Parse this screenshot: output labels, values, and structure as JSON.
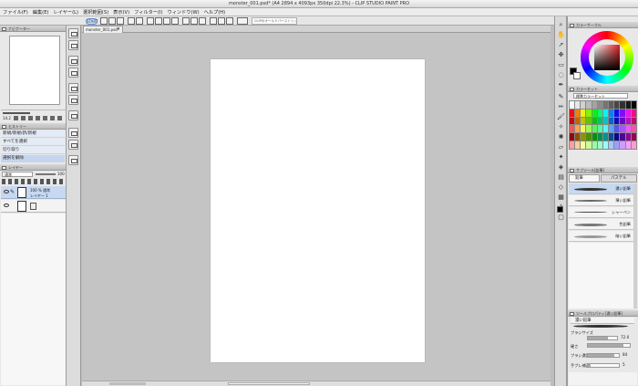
{
  "title": "monster_001.psd* (A4 2894 x 4093px 350dpi 22.3%) - CLIP STUDIO PAINT PRO",
  "menu": [
    "ファイル(F)",
    "編集(E)",
    "レイヤー(L)",
    "選択範囲(S)",
    "表示(V)",
    "フィルター(I)",
    "ウィンドウ(W)",
    "ヘルプ(H)"
  ],
  "cmd": {
    "start_label": "START",
    "search_placeholder": "CLIPのオールドバーストリップ"
  },
  "document_tab": "monster_001.psd*",
  "navigator": {
    "title": "ナビゲーター",
    "zoom": "14.2"
  },
  "history": {
    "title": "ヒストリー",
    "items": [
      "新規/新規/新/新規",
      "すべてを選択",
      "切り取り",
      "選択を解除"
    ]
  },
  "layers": {
    "title": "レイヤー",
    "blend": "通常",
    "opacity": "100",
    "rows": [
      {
        "name": "100 % 通常",
        "sub": "レイヤー 1"
      }
    ]
  },
  "color_wheel": {
    "title": "カラーサークル"
  },
  "color_set": {
    "title": "カラーセット",
    "set_name": "標準カラーセット"
  },
  "subtool": {
    "title": "サブツール[鉛筆]",
    "tabs": [
      "鉛筆",
      "パステル"
    ],
    "brushes": [
      "濃い鉛筆",
      "薄い鉛筆",
      "シャーペン",
      "色鉛筆",
      "暗い鉛筆"
    ]
  },
  "tool_property": {
    "title": "ツールプロパティ[濃い鉛筆]",
    "name": "濃い鉛筆",
    "brush_size_label": "ブラシサイズ",
    "brush_size": "72.0",
    "hardness_label": "硬さ",
    "density_label": "ブラシ濃度",
    "density": "84",
    "correction_label": "手ブレ補正",
    "correction": "5"
  },
  "colors": {
    "main": "#000000",
    "sub": "#ffffff",
    "accent": "#3366cc"
  }
}
